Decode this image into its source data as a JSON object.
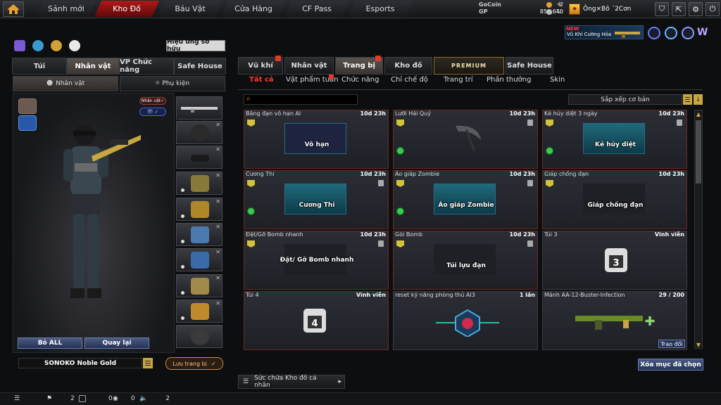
{
  "top_nav": {
    "tabs": [
      "Sảnh mới",
      "Kho Đồ",
      "Báu Vật",
      "Cửa Hàng",
      "CF Pass",
      "Esports"
    ],
    "active": "Kho Đồ"
  },
  "currency": {
    "gocoin_label": "GoCoin",
    "gocoin_value": "2",
    "gp_label": "GP",
    "gp_value": "851,640"
  },
  "player": {
    "name": "Ông×Bô ´2Cơn",
    "rank": "★"
  },
  "ad": {
    "badge": "NEW",
    "text": "Vũ Khí Cường Hóa"
  },
  "left": {
    "effect_button": "Hiệu ứng sở hữu",
    "tabs": [
      "Túi",
      "Nhân vật",
      "VP Chức năng",
      "Safe House"
    ],
    "subtabs": [
      "Nhân vật",
      "Phụ kiện"
    ],
    "character_badge": "Nhân vật✓",
    "reset_all": "Bỏ ALL",
    "back": "Quay lại",
    "preset_name": "SONOKO Noble Gold",
    "save_preset": "Lưu trang bị",
    "save_check": "✓"
  },
  "right": {
    "tabs": [
      "Vũ khí",
      "Nhân vật",
      "Trang bị",
      "Kho đồ",
      "PREMIUM",
      "Safe House"
    ],
    "filters": [
      "Tất cả",
      "Vật phẩm tuần",
      "Chức năng",
      "Chỉ chế độ",
      "Trang trí",
      "Phần thưởng",
      "Skin"
    ],
    "search_placeholder": "",
    "sort_label": "Sắp xếp cơ bản",
    "clear_selected": "Xóa mục đã chọn",
    "capacity": "Sức chứa Kho đồ cá nhân",
    "items": [
      {
        "name": "Băng đạn vô hạn AI",
        "time": "10d 23h",
        "caption": "Vô hạn"
      },
      {
        "name": "Lưỡi Hái Quỷ",
        "time": "10d 23h",
        "caption": ""
      },
      {
        "name": "Kẻ hủy diệt 3 ngày",
        "time": "10d 23h",
        "caption": "Kẻ hủy diệt"
      },
      {
        "name": "Cương Thi",
        "time": "10d 23h",
        "caption": "Cương Thi"
      },
      {
        "name": "Áo giáp Zombie",
        "time": "10d 23h",
        "caption": "Áo giáp Zombie"
      },
      {
        "name": "Giáp chống đạn",
        "time": "10d 23h",
        "caption": "Giáp chống đạn"
      },
      {
        "name": "Đặt/Gỡ Bomb nhanh",
        "time": "10d 23h",
        "caption": "Đặt/ Gỡ Bomb nhanh"
      },
      {
        "name": "Gói Bomb",
        "time": "10d 23h",
        "caption": "Túi lựu đạn"
      },
      {
        "name": "Túi 3",
        "time": "Vĩnh viễn",
        "caption": ""
      },
      {
        "name": "Túi  4",
        "time": "Vĩnh viễn",
        "caption": ""
      },
      {
        "name": "reset kỹ năng phòng thủ AI3",
        "time": "1 lần",
        "caption": ""
      },
      {
        "name": "Mảnh AA-12-Buster-Infection",
        "time": "29 / 200",
        "caption": "",
        "trade": "Trao đổi"
      }
    ]
  },
  "status": {
    "a": "2",
    "b": "0",
    "c": "0",
    "d": "2"
  },
  "colors": {
    "accent_red": "#b01818",
    "gold": "#c8a640",
    "blue_btn": "#243257"
  }
}
